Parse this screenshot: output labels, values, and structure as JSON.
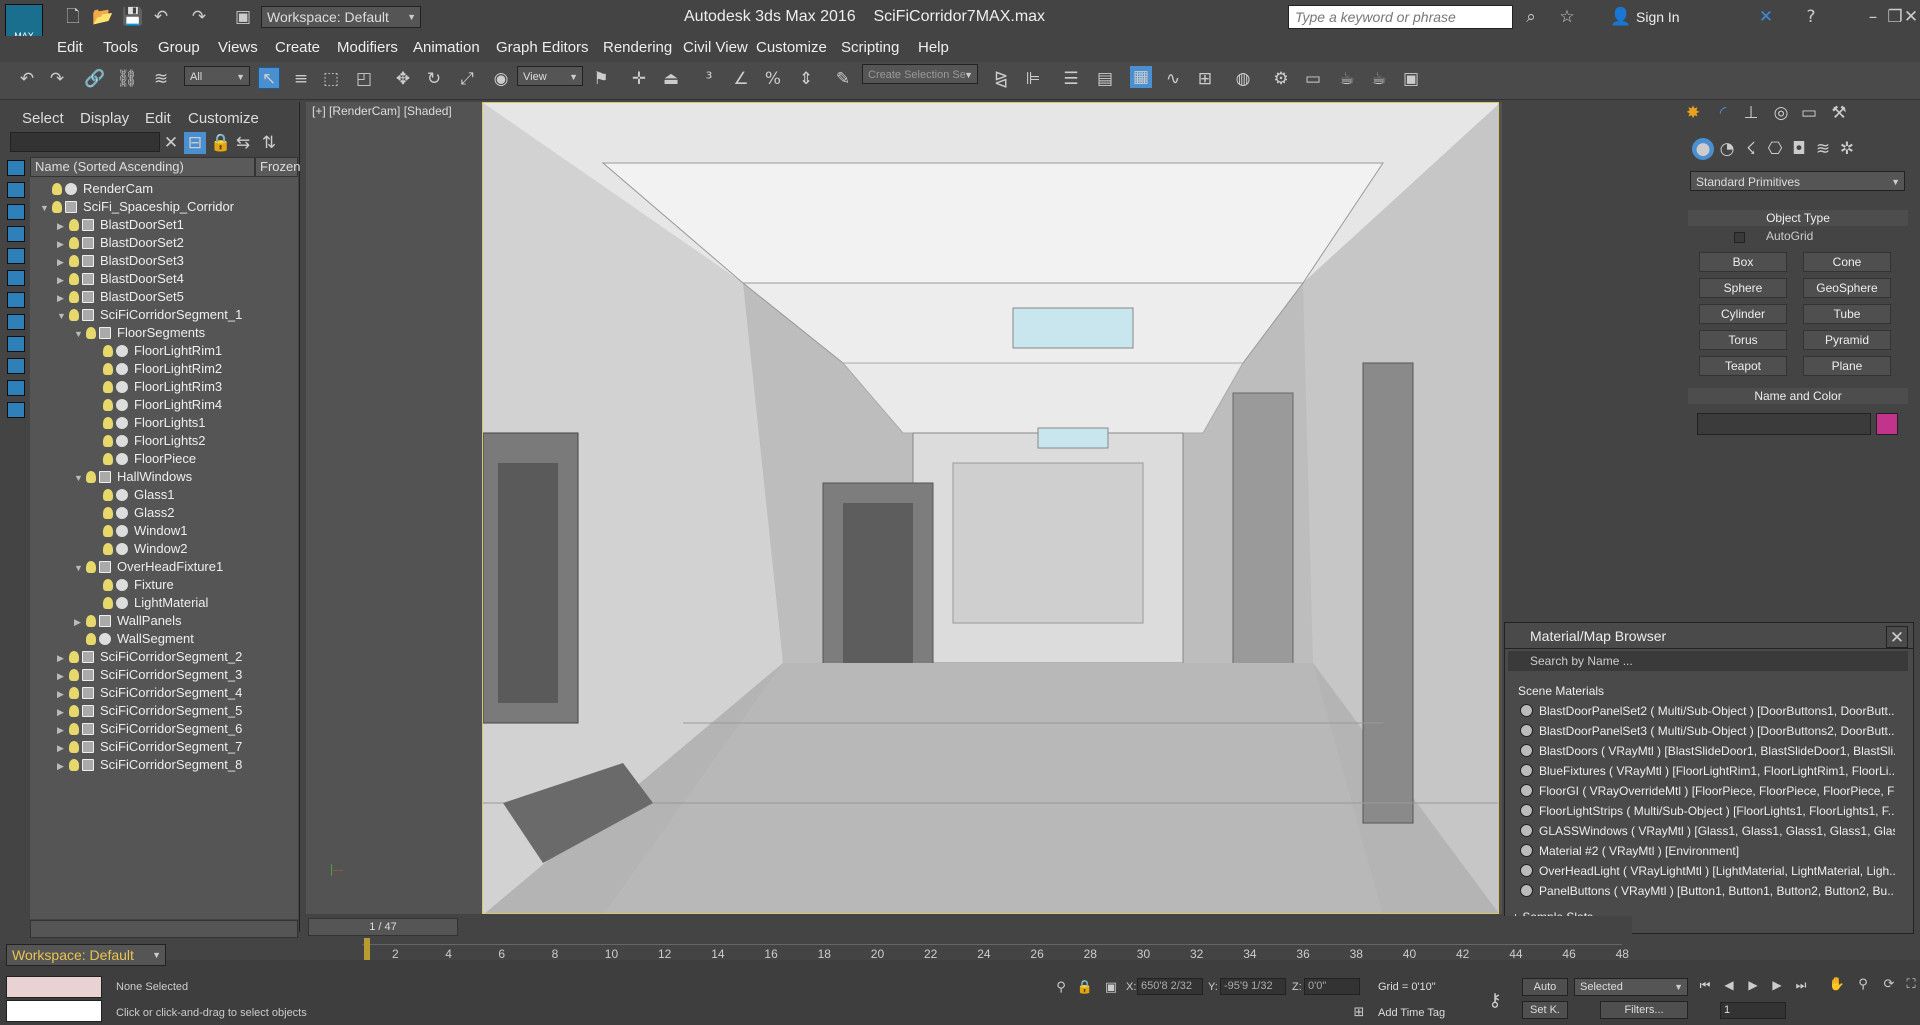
{
  "app": {
    "title": "Autodesk 3ds Max 2016",
    "file": "SciFiCorridor7MAX.max",
    "logo_text": "MAX",
    "workspace_dd": "Workspace: Default",
    "search_placeholder": "Type a keyword or phrase",
    "sign_in": "Sign In"
  },
  "menu": [
    "Edit",
    "Tools",
    "Group",
    "Views",
    "Create",
    "Modifiers",
    "Animation",
    "Graph Editors",
    "Rendering",
    "Civil View",
    "Customize",
    "Scripting",
    "Help"
  ],
  "toolbar": {
    "filter": "All",
    "ref_coord": "View",
    "selection_set": "Create Selection Se"
  },
  "scene_explorer": {
    "tabs": [
      "Select",
      "Display",
      "Edit",
      "Customize"
    ],
    "col_name": "Name (Sorted Ascending)",
    "col_frozen": "Frozen",
    "items": [
      {
        "label": "RenderCam",
        "depth": 0,
        "exp": ""
      },
      {
        "label": "SciFi_Spaceship_Corridor",
        "depth": 0,
        "exp": "▼"
      },
      {
        "label": "BlastDoorSet1",
        "depth": 1,
        "exp": "▶"
      },
      {
        "label": "BlastDoorSet2",
        "depth": 1,
        "exp": "▶"
      },
      {
        "label": "BlastDoorSet3",
        "depth": 1,
        "exp": "▶"
      },
      {
        "label": "BlastDoorSet4",
        "depth": 1,
        "exp": "▶"
      },
      {
        "label": "BlastDoorSet5",
        "depth": 1,
        "exp": "▶"
      },
      {
        "label": "SciFiCorridorSegment_1",
        "depth": 1,
        "exp": "▼"
      },
      {
        "label": "FloorSegments",
        "depth": 2,
        "exp": "▼"
      },
      {
        "label": "FloorLightRim1",
        "depth": 3,
        "exp": ""
      },
      {
        "label": "FloorLightRim2",
        "depth": 3,
        "exp": ""
      },
      {
        "label": "FloorLightRim3",
        "depth": 3,
        "exp": ""
      },
      {
        "label": "FloorLightRim4",
        "depth": 3,
        "exp": ""
      },
      {
        "label": "FloorLights1",
        "depth": 3,
        "exp": ""
      },
      {
        "label": "FloorLights2",
        "depth": 3,
        "exp": ""
      },
      {
        "label": "FloorPiece",
        "depth": 3,
        "exp": ""
      },
      {
        "label": "HallWindows",
        "depth": 2,
        "exp": "▼"
      },
      {
        "label": "Glass1",
        "depth": 3,
        "exp": ""
      },
      {
        "label": "Glass2",
        "depth": 3,
        "exp": ""
      },
      {
        "label": "Window1",
        "depth": 3,
        "exp": ""
      },
      {
        "label": "Window2",
        "depth": 3,
        "exp": ""
      },
      {
        "label": "OverHeadFixture1",
        "depth": 2,
        "exp": "▼"
      },
      {
        "label": "Fixture",
        "depth": 3,
        "exp": ""
      },
      {
        "label": "LightMaterial",
        "depth": 3,
        "exp": ""
      },
      {
        "label": "WallPanels",
        "depth": 2,
        "exp": "▶"
      },
      {
        "label": "WallSegment",
        "depth": 2,
        "exp": ""
      },
      {
        "label": "SciFiCorridorSegment_2",
        "depth": 1,
        "exp": "▶"
      },
      {
        "label": "SciFiCorridorSegment_3",
        "depth": 1,
        "exp": "▶"
      },
      {
        "label": "SciFiCorridorSegment_4",
        "depth": 1,
        "exp": "▶"
      },
      {
        "label": "SciFiCorridorSegment_5",
        "depth": 1,
        "exp": "▶"
      },
      {
        "label": "SciFiCorridorSegment_6",
        "depth": 1,
        "exp": "▶"
      },
      {
        "label": "SciFiCorridorSegment_7",
        "depth": 1,
        "exp": "▶"
      },
      {
        "label": "SciFiCorridorSegment_8",
        "depth": 1,
        "exp": "▶"
      }
    ]
  },
  "viewport": {
    "label": "[+] [RenderCam] [Shaded]"
  },
  "command_panel": {
    "category": "Standard Primitives",
    "object_type": "Object Type",
    "autogrid": "AutoGrid",
    "buttons": [
      "Box",
      "Cone",
      "Sphere",
      "GeoSphere",
      "Cylinder",
      "Tube",
      "Torus",
      "Pyramid",
      "Teapot",
      "Plane"
    ],
    "name_color": "Name and Color",
    "color": "#c2338b"
  },
  "mat_browser": {
    "title": "Material/Map Browser",
    "search": "Search by Name ...",
    "group": "Scene Materials",
    "sample_slots": "+ Sample Slots",
    "items": [
      "BlastDoorPanelSet2 ( Multi/Sub-Object ) [DoorButtons1, DoorButt...",
      "BlastDoorPanelSet3 ( Multi/Sub-Object ) [DoorButtons2, DoorButt...",
      "BlastDoors ( VRayMtl ) [BlastSlideDoor1, BlastSlideDoor1, BlastSli...",
      "BlueFixtures ( VRayMtl ) [FloorLightRim1, FloorLightRim1, FloorLi...",
      "FloorGI ( VRayOverrideMtl ) [FloorPiece, FloorPiece, FloorPiece, Fl...",
      "FloorLightStrips ( Multi/Sub-Object ) [FloorLights1, FloorLights1, F...",
      "GLASSWindows ( VRayMtl ) [Glass1, Glass1, Glass1, Glass1, Glass...",
      "Material #2 ( VRayMtl ) [Environment]",
      "OverHeadLight ( VRayLightMtl ) [LightMaterial, LightMaterial, Ligh...",
      "PanelButtons ( VRayMtl ) [Button1, Button1, Button2, Button2, Bu..."
    ]
  },
  "timeline": {
    "frame": "1 / 47",
    "ticks": [
      "2",
      "4",
      "6",
      "8",
      "10",
      "12",
      "14",
      "16",
      "18",
      "20",
      "22",
      "24",
      "26",
      "28",
      "30",
      "32",
      "34",
      "36",
      "38",
      "40",
      "42",
      "44",
      "46",
      "48"
    ]
  },
  "status": {
    "workspace": "Workspace: Default",
    "selection": "None Selected",
    "prompt": "Click or click-and-drag to select objects",
    "x": "650'8 2/32",
    "y": "-95'9 1/32",
    "z": "0'0\"",
    "grid": "Grid = 0'10\"",
    "add_time_tag": "Add Time Tag",
    "auto": "Auto",
    "set_key": "Set K.",
    "key_mode": "Selected",
    "filters": "Filters...",
    "frame_field": "1"
  }
}
